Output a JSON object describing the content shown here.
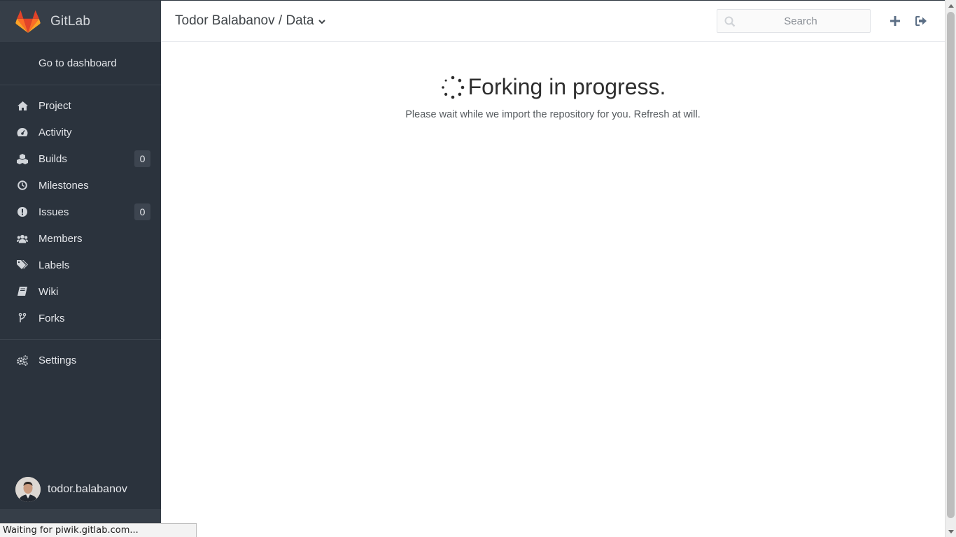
{
  "app": {
    "brand_name": "GitLab",
    "brand_colors": {
      "logo_orange": "#e24329",
      "logo_light": "#fc6d26",
      "logo_yellow": "#fca326"
    }
  },
  "sidebar": {
    "dashboard_link": "Go to dashboard",
    "items": [
      {
        "label": "Project",
        "icon": "home-icon"
      },
      {
        "label": "Activity",
        "icon": "dashboard-icon"
      },
      {
        "label": "Builds",
        "icon": "cubes-icon",
        "count": "0"
      },
      {
        "label": "Milestones",
        "icon": "clock-icon"
      },
      {
        "label": "Issues",
        "icon": "exclamation-circle-icon",
        "count": "0"
      },
      {
        "label": "Members",
        "icon": "users-icon"
      },
      {
        "label": "Labels",
        "icon": "tags-icon"
      },
      {
        "label": "Wiki",
        "icon": "book-icon"
      },
      {
        "label": "Forks",
        "icon": "code-fork-icon"
      }
    ],
    "settings": {
      "label": "Settings",
      "icon": "cogs-icon"
    },
    "user": {
      "name": "todor.balabanov"
    }
  },
  "header": {
    "breadcrumb": "Todor Balabanov / Data",
    "search_placeholder": "Search",
    "new_icon": "plus-icon",
    "signout_icon": "sign-out-icon"
  },
  "main": {
    "title": "Forking in progress.",
    "subtitle": "Please wait while we import the repository for you. Refresh at will."
  },
  "statusbar": {
    "text": "Waiting for piwik.gitlab.com..."
  }
}
